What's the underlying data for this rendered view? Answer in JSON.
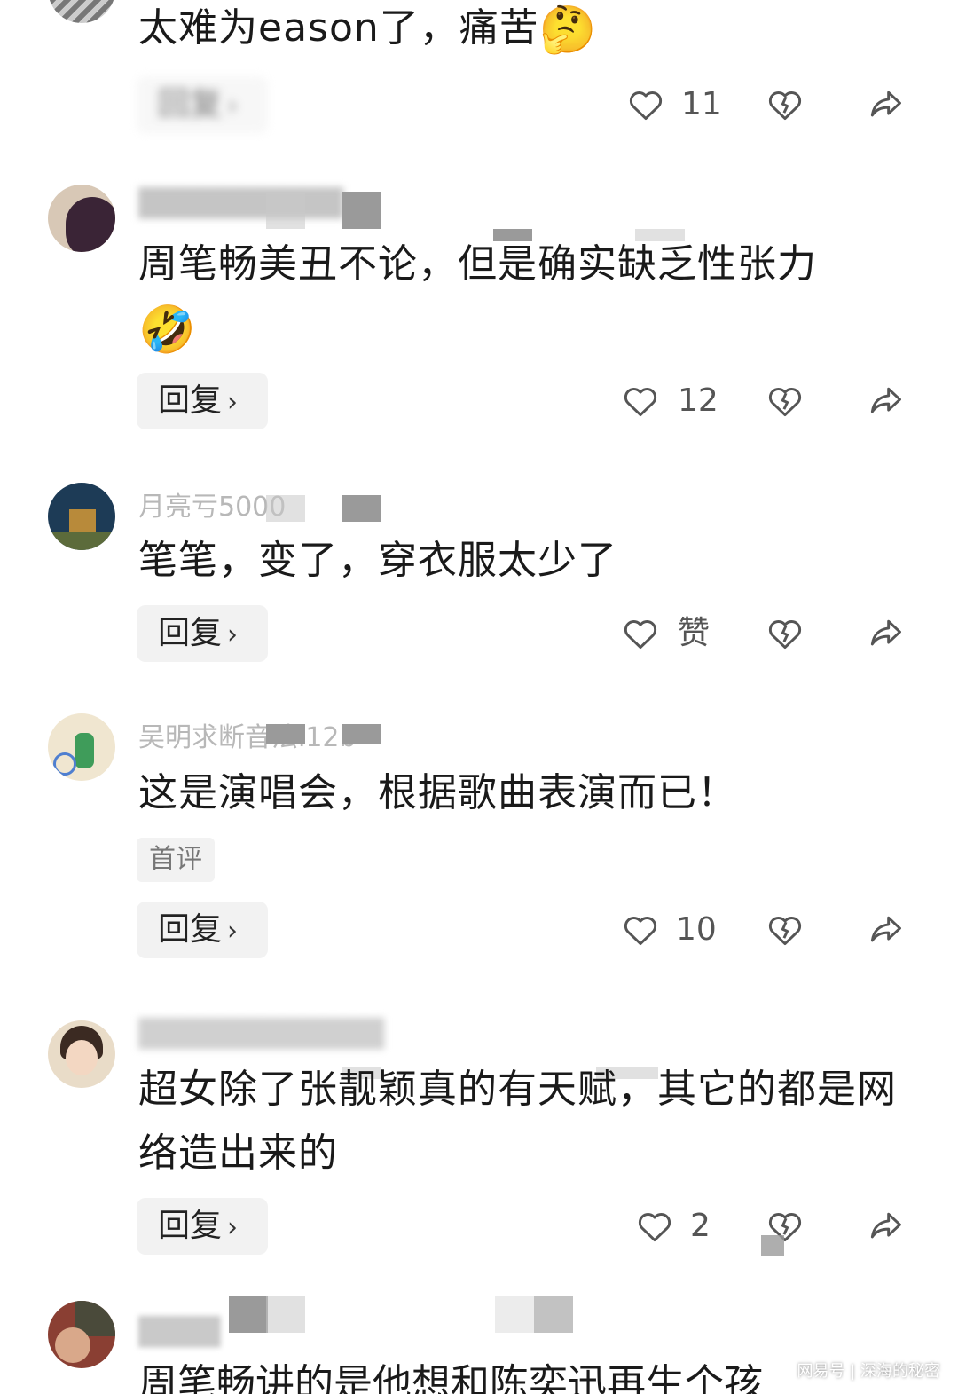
{
  "comments": [
    {
      "text": "太难为eason了，痛苦",
      "emoji": "🤔",
      "reply_label": "回复",
      "like_count": "11"
    },
    {
      "text": "周笔畅美丑不论，但是确实缺乏性张力",
      "emoji": "🤣",
      "reply_label": "回复",
      "like_count": "12"
    },
    {
      "text": "笔笔，变了，穿衣服太少了",
      "reply_label": "回复",
      "like_count": "赞"
    },
    {
      "text": "这是演唱会，根据歌曲表演而已！",
      "badge": "首评",
      "reply_label": "回复",
      "like_count": "10"
    },
    {
      "text": "超女除了张靓颖真的有天赋，其它的都是网络造出来的",
      "reply_label": "回复",
      "like_count": "2"
    },
    {
      "text": "周笔畅讲的是他想和陈奕迅再生个孩"
    }
  ],
  "usernames": [
    "月亮亏5000",
    "吴明求断音法l12b"
  ],
  "watermark": "网易号 | 深海的秘密",
  "icons": {
    "like": "heart-outline-icon",
    "dislike": "broken-heart-icon",
    "share": "share-arrow-icon",
    "chevron": "chevron-right-icon"
  }
}
